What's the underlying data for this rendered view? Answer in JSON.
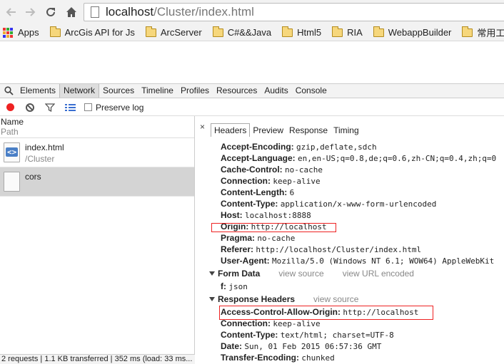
{
  "browser": {
    "url_host": "localhost",
    "url_path": "/Cluster/index.html",
    "bookmarks": [
      "Apps",
      "ArcGis API for Js",
      "ArcServer",
      "C#&&Java",
      "Html5",
      "RIA",
      "WebappBuilder",
      "常用工具网站"
    ]
  },
  "devtools": {
    "tabs": [
      "Elements",
      "Network",
      "Sources",
      "Timeline",
      "Profiles",
      "Resources",
      "Audits",
      "Console"
    ],
    "active_tab": "Network",
    "preserve_log_label": "Preserve log",
    "list_header": {
      "name": "Name",
      "path": "Path"
    },
    "requests": [
      {
        "name": "index.html",
        "path": "/Cluster",
        "selected": false
      },
      {
        "name": "cors",
        "path": "",
        "selected": true
      }
    ],
    "status": "2 requests | 1.1 KB transferred | 352 ms (load: 33 ms..."
  },
  "detail": {
    "close": "×",
    "tabs": [
      "Headers",
      "Preview",
      "Response",
      "Timing"
    ],
    "active_tab": "Headers",
    "request_headers": [
      {
        "k": "Accept-Encoding:",
        "v": "gzip,deflate,sdch"
      },
      {
        "k": "Accept-Language:",
        "v": "en,en-US;q=0.8,de;q=0.6,zh-CN;q=0.4,zh;q=0"
      },
      {
        "k": "Cache-Control:",
        "v": "no-cache"
      },
      {
        "k": "Connection:",
        "v": "keep-alive"
      },
      {
        "k": "Content-Length:",
        "v": "6"
      },
      {
        "k": "Content-Type:",
        "v": "application/x-www-form-urlencoded"
      },
      {
        "k": "Host:",
        "v": "localhost:8888"
      },
      {
        "k": "Origin:",
        "v": "http://localhost"
      },
      {
        "k": "Pragma:",
        "v": "no-cache"
      },
      {
        "k": "Referer:",
        "v": "http://localhost/Cluster/index.html"
      },
      {
        "k": "User-Agent:",
        "v": "Mozilla/5.0 (Windows NT 6.1; WOW64) AppleWebKit"
      }
    ],
    "form_data": {
      "title": "Form Data",
      "link1": "view source",
      "link2": "view URL encoded",
      "rows": [
        {
          "k": "f:",
          "v": "json"
        }
      ]
    },
    "response_headers": {
      "title": "Response Headers",
      "link1": "view source",
      "rows": [
        {
          "k": "Access-Control-Allow-Origin:",
          "v": "http://localhost"
        },
        {
          "k": "Connection:",
          "v": "keep-alive"
        },
        {
          "k": "Content-Type:",
          "v": "text/html; charset=UTF-8"
        },
        {
          "k": "Date:",
          "v": "Sun, 01 Feb 2015 06:57:36 GMT"
        },
        {
          "k": "Transfer-Encoding:",
          "v": "chunked"
        }
      ]
    }
  }
}
